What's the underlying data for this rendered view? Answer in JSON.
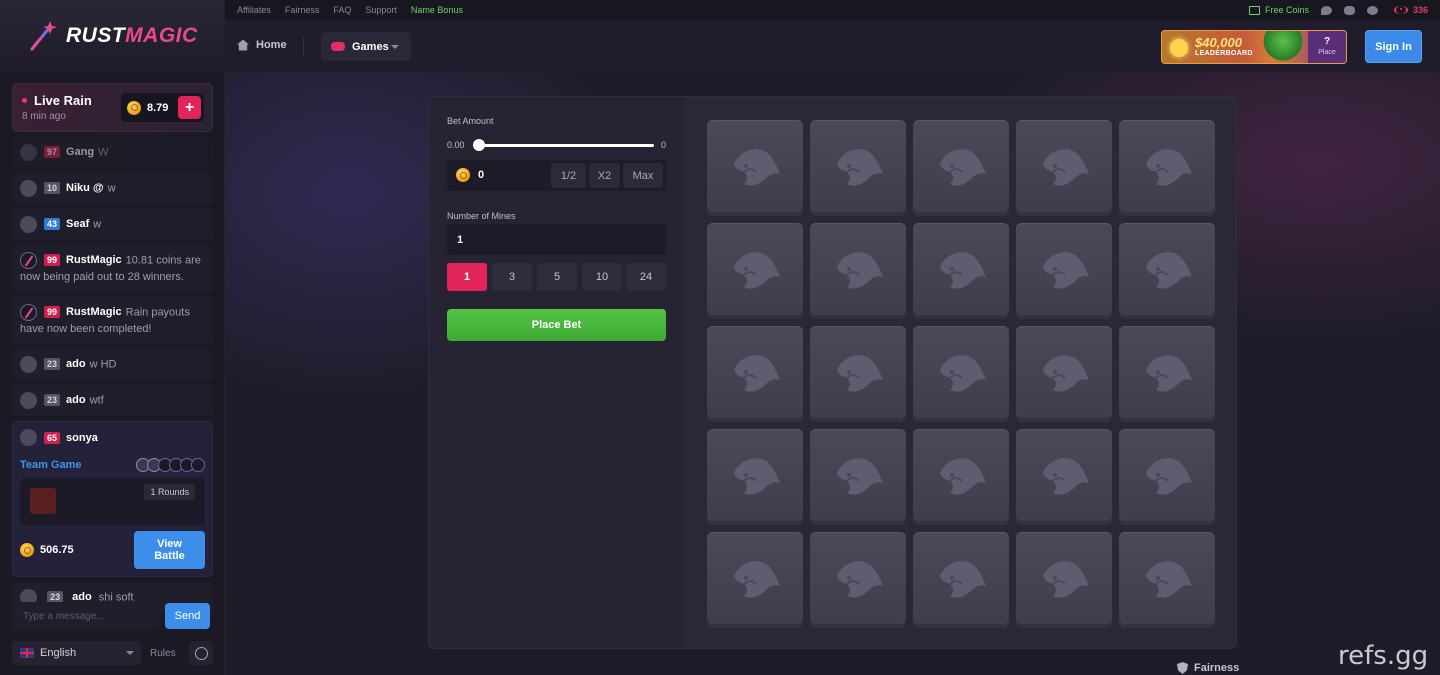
{
  "brand": {
    "logo_white": "RUST",
    "logo_pink": "MAGIC"
  },
  "rain": {
    "title": "Live Rain",
    "time": "8 min ago",
    "amount": "8.79",
    "add_label": "+"
  },
  "chat": {
    "messages": [
      {
        "level": "97",
        "level_color": "red",
        "user": "Gang",
        "text": "W",
        "dim": true
      },
      {
        "level": "10",
        "level_color": "gray",
        "user": "Niku @",
        "text": "w"
      },
      {
        "level": "43",
        "level_color": "blue",
        "user": "Seaf",
        "text": "w"
      },
      {
        "level": "99",
        "level_color": "red",
        "user": "RustMagic",
        "text": "10.81 coins are now being paid out to 28 winners."
      },
      {
        "level": "99",
        "level_color": "red",
        "user": "RustMagic",
        "text": "Rain payouts have now been completed!"
      },
      {
        "level": "23",
        "level_color": "gray",
        "user": "ado",
        "text": "w HD"
      },
      {
        "level": "23",
        "level_color": "gray",
        "user": "ado",
        "text": "wtf"
      }
    ],
    "team_card": {
      "level": "65",
      "user": "sonya",
      "label": "Team Game",
      "rounds": "1 Rounds",
      "amount": "506.75",
      "button": "View Battle"
    },
    "last_message": {
      "level": "23",
      "user": "ado",
      "text": "shi soft"
    },
    "input_placeholder": "Type a message...",
    "send_label": "Send",
    "language": "English",
    "rules_label": "Rules"
  },
  "topbar": {
    "links": [
      "Affiliates",
      "Fairness",
      "FAQ",
      "Support"
    ],
    "highlight_link": "Name Bonus",
    "free_coins": "Free Coins",
    "online": "336"
  },
  "nav": {
    "home": "Home",
    "games": "Games",
    "signin": "Sign In"
  },
  "leaderboard": {
    "amount": "$40,000",
    "label": "LEADERBOARD",
    "place_q": "?",
    "place_label": "Place"
  },
  "game": {
    "bet_amount_label": "Bet Amount",
    "slider_min": "0.00",
    "slider_max": "0",
    "bet_value": "0",
    "quick_buttons": [
      "1/2",
      "X2",
      "Max"
    ],
    "mines_label": "Number of Mines",
    "mines_value": "1",
    "mine_options": [
      "1",
      "3",
      "5",
      "10",
      "24"
    ],
    "mine_selected": "1",
    "place_bet": "Place Bet",
    "grid_size": 5
  },
  "footer": {
    "fairness": "Fairness",
    "watermark": "refs.gg"
  },
  "colors": {
    "accent_pink": "#e2245b",
    "accent_blue": "#3d8ee9",
    "accent_green": "#55c346"
  }
}
